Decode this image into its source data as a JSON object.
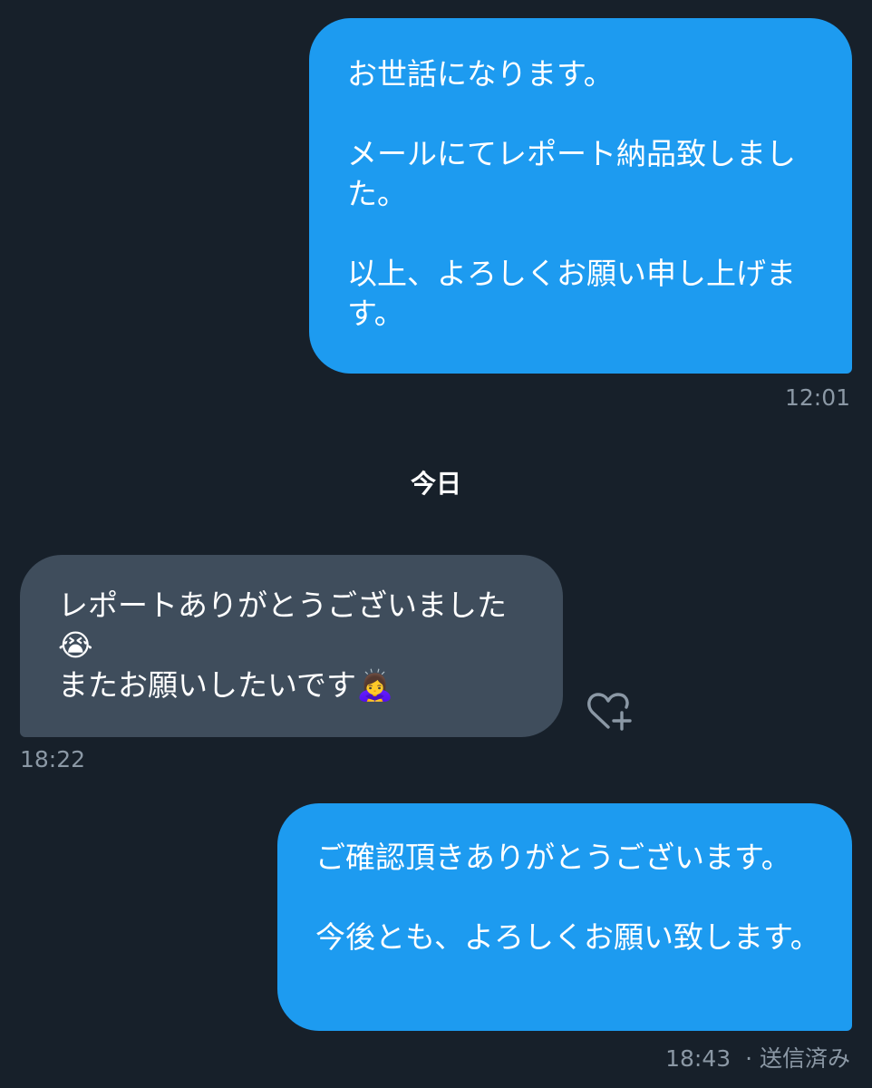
{
  "messages": [
    {
      "direction": "sent",
      "text": "お世話になります。\n\nメールにてレポート納品致しました。\n\n以上、よろしくお願い申し上げます。",
      "time": "12:01"
    },
    {
      "direction": "received",
      "text": "レポートありがとうございました😭\nまたお願いしたいです🙇‍♀️",
      "time": "18:22"
    },
    {
      "direction": "sent",
      "text": "ご確認頂きありがとうございます。\n\n今後とも、よろしくお願い致します。",
      "time": "18:43",
      "status": "· 送信済み"
    }
  ],
  "day_divider": "今日",
  "react_icon": "heart-plus-icon",
  "colors": {
    "background": "#17202a",
    "sent_bubble": "#1d9bf0",
    "received_bubble": "#3f4d5c",
    "meta_text": "#8b98a5"
  }
}
